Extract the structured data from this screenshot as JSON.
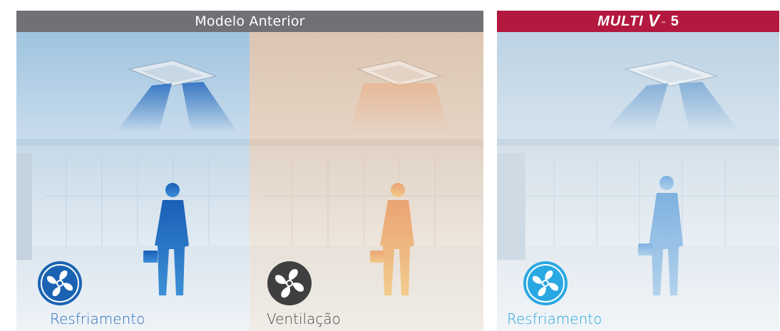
{
  "headers": {
    "previous_model": "Modelo Anterior",
    "new_model": {
      "multi": "MULTI",
      "v": "V",
      "tm": "™",
      "number": "5"
    }
  },
  "panels": [
    {
      "mode_label": "Resfriamento",
      "icon": "cooling-fan-icon",
      "label_color": "#2b6db8"
    },
    {
      "mode_label": "Ventilação",
      "icon": "fan-icon",
      "label_color": "#4a4a4a"
    },
    {
      "mode_label": "Resfriamento",
      "icon": "cooling-fan-icon",
      "label_color": "#29a6e0"
    }
  ],
  "colors": {
    "header_gray": "#707175",
    "header_red": "#b3183e",
    "cool_blue": "#1b63b2",
    "fan_gray": "#3f3f3f",
    "light_blue": "#2aa8e2"
  }
}
